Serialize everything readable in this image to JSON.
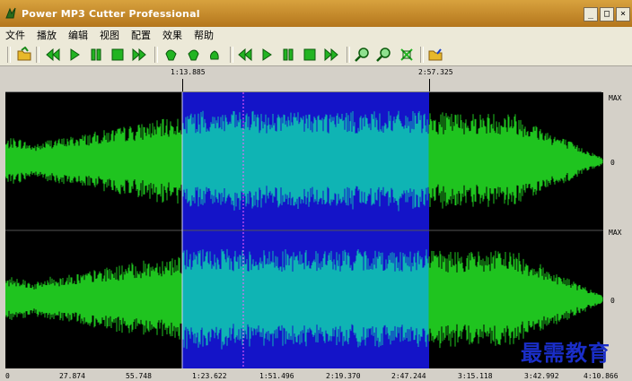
{
  "window": {
    "title": "Power MP3 Cutter Professional"
  },
  "window_buttons": [
    "_",
    "□",
    "×"
  ],
  "menu": [
    "文件",
    "播放",
    "编辑",
    "视图",
    "配置",
    "效果",
    "帮助"
  ],
  "toolbar_icons": [
    "open-folder-icon",
    "rewind-icon",
    "play-icon",
    "pause-icon",
    "stop-icon",
    "forward-icon",
    "set-start-icon",
    "set-end-icon",
    "play-selection-icon",
    "rewind-icon",
    "play-icon",
    "pause-icon",
    "stop-icon",
    "forward-icon",
    "zoom-in-icon",
    "zoom-out-icon",
    "zoom-fit-icon",
    "save-icon"
  ],
  "ruler": {
    "start_label": "1:13.885",
    "end_label": "2:57.325"
  },
  "channels": {
    "max_label": "MAX",
    "zero_label": "0"
  },
  "timeline": [
    "0",
    "27.874",
    "55.748",
    "1:23.622",
    "1:51.496",
    "2:19.370",
    "2:47.244",
    "3:15.118",
    "3:42.992",
    "4:10.866"
  ],
  "watermark": "最需教育",
  "colors": {
    "waveform": "#1fc41f",
    "selection_bg": "#1414c8",
    "selection_wave": "#0fb4b4",
    "background": "#000000"
  }
}
